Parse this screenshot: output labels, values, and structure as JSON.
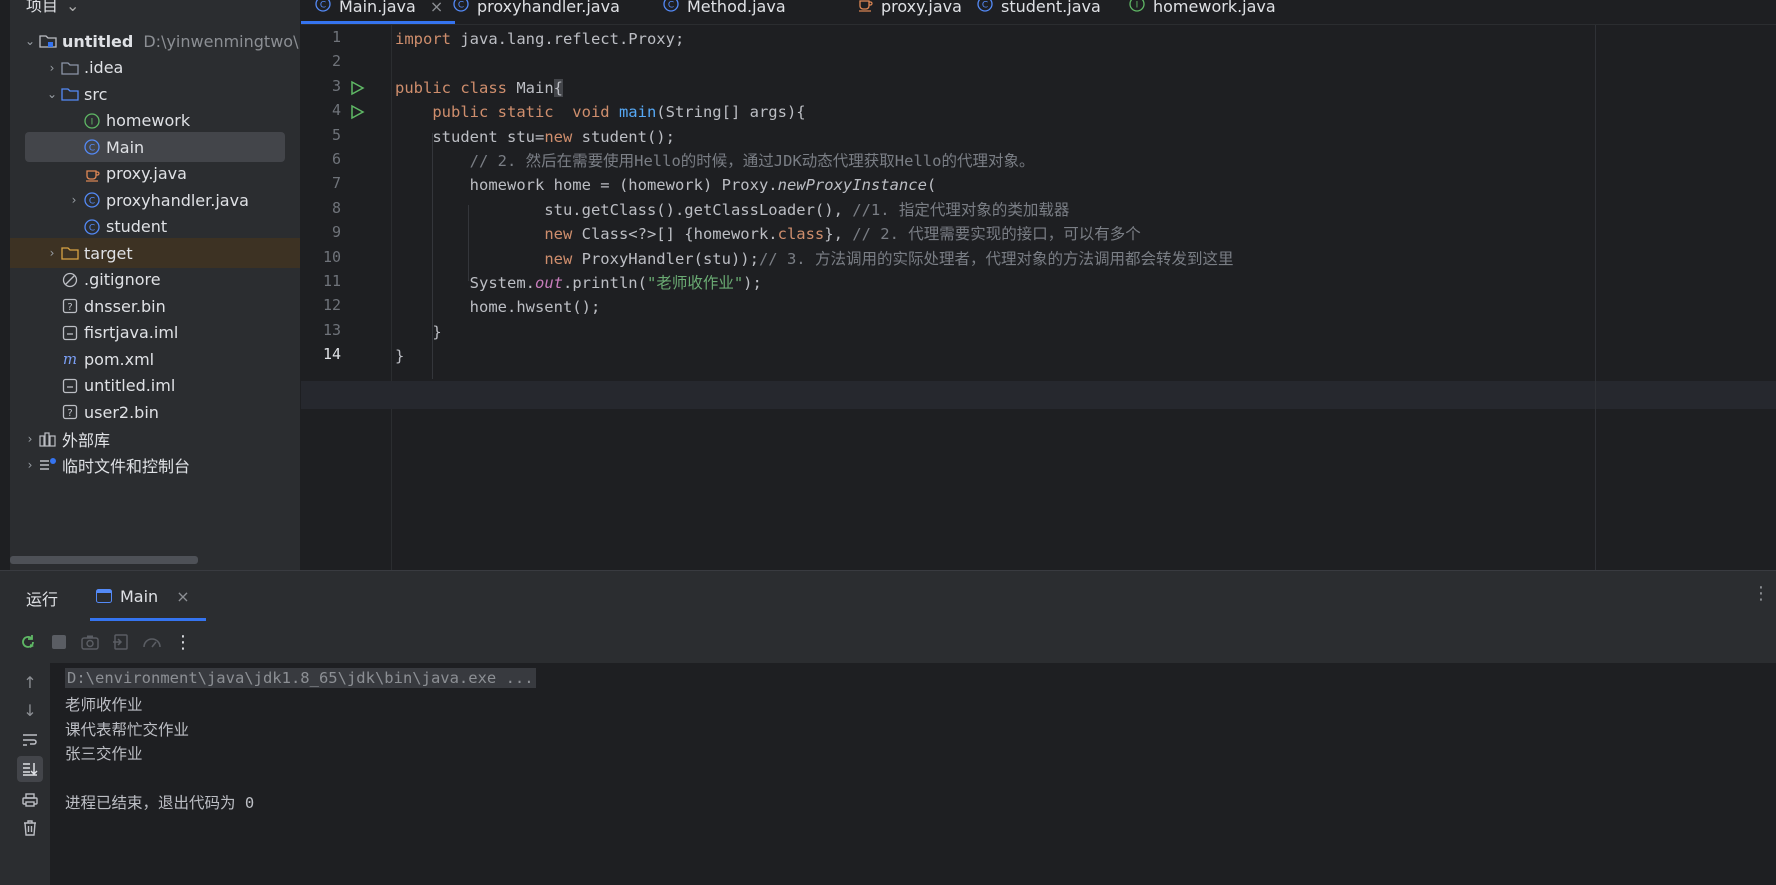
{
  "project_panel": {
    "title": "项目",
    "items": [
      {
        "label": "untitled",
        "path": "D:\\yinwenmingtwo\\",
        "icon": "module-icon",
        "arrow": "expanded",
        "bold": true
      },
      {
        "label": ".idea",
        "icon": "folder-icon",
        "arrow": "collapsed"
      },
      {
        "label": "src",
        "icon": "source-folder-icon",
        "arrow": "expanded"
      },
      {
        "label": "homework",
        "icon": "interface-icon",
        "arrow": "none"
      },
      {
        "label": "Main",
        "icon": "class-icon",
        "arrow": "none",
        "selected": true
      },
      {
        "label": "proxy.java",
        "icon": "java-file-icon",
        "arrow": "none"
      },
      {
        "label": "proxyhandler.java",
        "icon": "class-icon",
        "arrow": "collapsed"
      },
      {
        "label": "student",
        "icon": "class-icon",
        "arrow": "none"
      },
      {
        "label": "target",
        "icon": "excluded-folder-icon",
        "arrow": "collapsed",
        "excluded": true
      },
      {
        "label": ".gitignore",
        "icon": "ignore-file-icon",
        "arrow": "none"
      },
      {
        "label": "dnsser.bin",
        "icon": "unknown-file-icon",
        "arrow": "none"
      },
      {
        "label": "fisrtjava.iml",
        "icon": "iml-file-icon",
        "arrow": "none"
      },
      {
        "label": "pom.xml",
        "icon": "maven-icon",
        "arrow": "none"
      },
      {
        "label": "untitled.iml",
        "icon": "iml-file-icon",
        "arrow": "none"
      },
      {
        "label": "user2.bin",
        "icon": "unknown-file-icon",
        "arrow": "none"
      },
      {
        "label": "外部库",
        "icon": "library-icon",
        "arrow": "collapsed"
      },
      {
        "label": "临时文件和控制台",
        "icon": "scratches-icon",
        "arrow": "collapsed"
      }
    ]
  },
  "editor": {
    "tabs": [
      {
        "label": "Main.java",
        "icon": "class-icon",
        "active": true,
        "close": "×"
      },
      {
        "label": "proxyhandler.java",
        "icon": "class-icon"
      },
      {
        "label": "Method.java",
        "icon": "class-icon"
      },
      {
        "label": "proxy.java",
        "icon": "java-file-icon"
      },
      {
        "label": "student.java",
        "icon": "class-icon"
      },
      {
        "label": "homework.java",
        "icon": "interface-icon"
      }
    ],
    "current_line": 14,
    "lines": [
      [
        {
          "t": "import ",
          "c": "kw"
        },
        {
          "t": "java.lang.reflect.Proxy;",
          "c": "plain"
        }
      ],
      [],
      [
        {
          "t": "public class ",
          "c": "kw"
        },
        {
          "t": "Main",
          "c": "plain"
        },
        {
          "t": "{",
          "c": "brace"
        }
      ],
      [
        {
          "t": "    public static  void ",
          "c": "kw"
        },
        {
          "t": "main",
          "c": "fn"
        },
        {
          "t": "(String[] args){",
          "c": "plain"
        }
      ],
      [
        {
          "t": "    student stu=",
          "c": "plain"
        },
        {
          "t": "new ",
          "c": "kw"
        },
        {
          "t": "student();",
          "c": "plain"
        }
      ],
      [
        {
          "t": "        // 2. 然后在需要使用Hello的时候，通过JDK动态代理获取Hello的代理对象。",
          "c": "cm"
        }
      ],
      [
        {
          "t": "        homework home = (homework) Proxy.",
          "c": "plain"
        },
        {
          "t": "newProxyInstance",
          "c": "it"
        },
        {
          "t": "(",
          "c": "plain"
        }
      ],
      [
        {
          "t": "                stu.getClass().getClassLoader(), ",
          "c": "plain"
        },
        {
          "t": "//1. 指定代理对象的类加载器",
          "c": "cm"
        }
      ],
      [
        {
          "t": "                ",
          "c": "plain"
        },
        {
          "t": "new ",
          "c": "kw"
        },
        {
          "t": "Class<?>[] {homework.",
          "c": "plain"
        },
        {
          "t": "class",
          "c": "kw"
        },
        {
          "t": "}, ",
          "c": "plain"
        },
        {
          "t": "// 2. 代理需要实现的接口，可以有多个",
          "c": "cm"
        }
      ],
      [
        {
          "t": "                ",
          "c": "plain"
        },
        {
          "t": "new ",
          "c": "kw"
        },
        {
          "t": "ProxyHandler(stu));",
          "c": "plain"
        },
        {
          "t": "// 3. 方法调用的实际处理者，代理对象的方法调用都会转发到这里",
          "c": "cm"
        }
      ],
      [
        {
          "t": "        System.",
          "c": "plain"
        },
        {
          "t": "out",
          "c": "field"
        },
        {
          "t": ".println(",
          "c": "plain"
        },
        {
          "t": "\"老师收作业\"",
          "c": "str"
        },
        {
          "t": ");",
          "c": "plain"
        }
      ],
      [
        {
          "t": "        home.hwsent();",
          "c": "plain"
        }
      ],
      [
        {
          "t": "    }",
          "c": "plain"
        }
      ],
      [
        {
          "t": "}",
          "c": "plain"
        }
      ]
    ],
    "line_numbers": [
      "1",
      "2",
      "3",
      "4",
      "5",
      "6",
      "7",
      "8",
      "9",
      "10",
      "11",
      "12",
      "13",
      "14"
    ],
    "run_gutter_lines": [
      3,
      4
    ]
  },
  "run_panel": {
    "title": "运行",
    "tab_label": "Main",
    "tab_close": "×",
    "more": "⋮",
    "console_lines": [
      {
        "text": "D:\\environment\\java\\jdk1.8_65\\jdk\\bin\\java.exe ...",
        "type": "cmd"
      },
      {
        "text": "老师收作业",
        "type": "out"
      },
      {
        "text": "课代表帮忙交作业",
        "type": "out"
      },
      {
        "text": "张三交作业",
        "type": "out"
      },
      {
        "text": "",
        "type": "out"
      },
      {
        "text": "进程已结束，退出代码为 0",
        "type": "out"
      }
    ]
  },
  "colors": {
    "kw": "#cf8e6d",
    "plain": "#bcbec4",
    "fn": "#56a8f5",
    "cm": "#7a7e85",
    "str": "#6aab73",
    "field": "#c77dbb",
    "it": "#bcbec4",
    "brace": "#bcbec4",
    "accent": "#3574f0",
    "class": "#548af7",
    "interface": "#5fb865",
    "java": "#e08855",
    "folder": "#8c96a8",
    "excluded": "#d9a343"
  }
}
